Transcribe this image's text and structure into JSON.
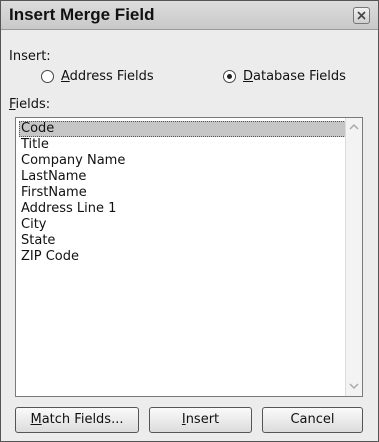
{
  "dialog": {
    "title": "Insert Merge Field",
    "insert_label": "Insert:",
    "radio": {
      "address": {
        "prefix": "",
        "underlined": "A",
        "rest": "ddress Fields",
        "checked": false
      },
      "database": {
        "prefix": "",
        "underlined": "D",
        "rest": "atabase Fields",
        "checked": true
      }
    },
    "fields_label": {
      "underlined": "F",
      "rest": "ields:"
    },
    "fields": [
      "Code",
      "Title",
      "Company Name",
      "LastName",
      "FirstName",
      "Address Line 1",
      "City",
      "State",
      "ZIP Code"
    ],
    "selected_field": "Code",
    "buttons": {
      "match": {
        "underlined": "M",
        "rest": "atch Fields..."
      },
      "insert": {
        "underlined": "I",
        "rest": "nsert"
      },
      "cancel": "Cancel"
    }
  },
  "icons": {
    "close": "close-icon",
    "scroll_up": "chevron-up-icon",
    "scroll_down": "chevron-down-icon"
  }
}
